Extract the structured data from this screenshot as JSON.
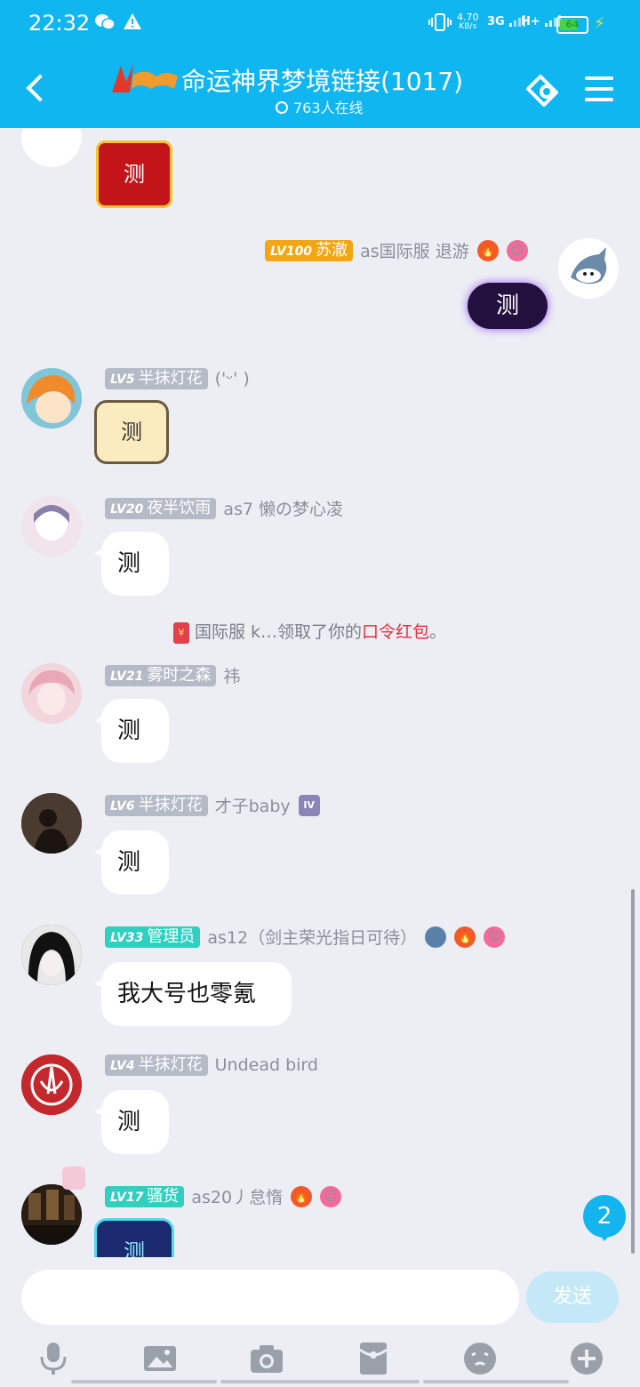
{
  "status_bar": {
    "time": "22:32",
    "net_speed": "4.70",
    "net_unit": "KB/s",
    "signal1": "3G",
    "signal2": "H+",
    "battery": "64"
  },
  "header": {
    "title": "命运神界梦境链接(1017)",
    "online": "763人在线"
  },
  "messages": [
    {
      "level": "LV100",
      "role": "苏澈",
      "name": "as国际服 退游",
      "text": "测"
    },
    {
      "level": "LV5",
      "role": "半抹灯花",
      "name": "('ᵕ' )",
      "text": "测"
    },
    {
      "level": "LV20",
      "role": "夜半饮雨",
      "name": "as7  懒の梦心凌",
      "text": "测"
    },
    {
      "level": "LV21",
      "role": "雾时之森",
      "name": "祎",
      "text": "测"
    },
    {
      "level": "LV6",
      "role": "半抹灯花",
      "name": "才子baby",
      "text": "测",
      "badge": "IV"
    },
    {
      "level": "LV33",
      "role": "管理员",
      "name": "as12（剑主荣光指日可待）",
      "text": "我大号也零氪"
    },
    {
      "level": "LV4",
      "role": "半抹灯花",
      "name": "Undead bird",
      "text": "测"
    },
    {
      "level": "LV17",
      "role": "骚货",
      "name": "as20丿怠惰",
      "text": "测"
    }
  ],
  "first_message_text": "测",
  "system_notice": {
    "prefix": "国际服 k…领取了你的",
    "highlight": "口令红包",
    "suffix": "。",
    "icon_char": "¥"
  },
  "unread_count": "2",
  "input": {
    "placeholder": "",
    "send_label": "发送"
  },
  "colors": {
    "header_bg": "#10b6ef",
    "chat_bg": "#eceef4",
    "lv_gold": "#f3a612",
    "lv_teal": "#2fd0c0",
    "lv_gray": "#b4bac6",
    "highlight_red": "#e52d3d"
  },
  "toolbar_icons": [
    "microphone-icon",
    "image-icon",
    "camera-icon",
    "red-packet-icon",
    "emoji-icon",
    "plus-icon"
  ]
}
